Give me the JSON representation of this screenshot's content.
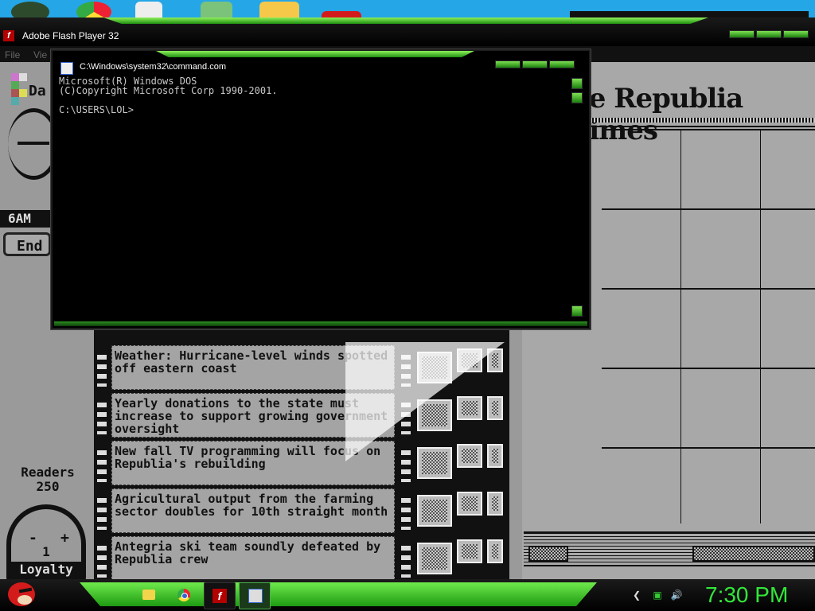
{
  "flash_window": {
    "title": "Adobe Flash Player 32",
    "menu": [
      "File",
      "Vie"
    ]
  },
  "cmd_window": {
    "title": "C:\\Windows\\system32\\command.com",
    "lines": [
      "Microsoft(R) Windows DOS",
      "(C)Copyright Microsoft Corp 1990-2001.",
      "",
      "C:\\USERS\\LOL>"
    ]
  },
  "game": {
    "day_label": "Da",
    "time_label": "6AM",
    "end_button": "End",
    "readers_label": "Readers",
    "readers_count": "250",
    "loyalty_minus": "-",
    "loyalty_plus": "+",
    "loyalty_value": "1",
    "loyalty_label": "Loyalty",
    "newspaper_title": "he Republia Times",
    "stories": [
      "Weather: Hurricane-level winds spotted off eastern coast",
      "Yearly donations to the state must increase to support growing government oversight",
      "New fall TV programming will focus on Republia's rebuilding",
      "Agricultural output from the farming sector doubles for 10th straight month",
      "Antegria ski team soundly defeated by Republia crew"
    ]
  },
  "taskbar": {
    "clock": "7:30 PM",
    "accent_color": "#33e63a",
    "pinned": [
      "folder-icon",
      "chrome-icon",
      "flash-player-icon",
      "command-prompt-icon"
    ]
  }
}
